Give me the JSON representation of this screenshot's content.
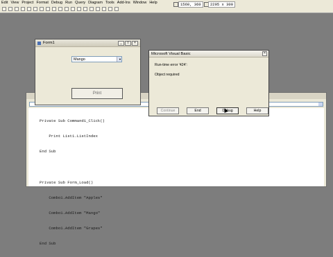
{
  "menu": [
    "Edit",
    "View",
    "Project",
    "Format",
    "Debug",
    "Run",
    "Query",
    "Diagram",
    "Tools",
    "Add-Ins",
    "Window",
    "Help"
  ],
  "toolbar": {
    "position": "1560, 360",
    "size": "2295 x 300"
  },
  "code": {
    "lines": [
      "Private Sub Command1_Click()",
      "    Print List1.ListIndex",
      "End Sub",
      "",
      "Private Sub Form_Load()",
      "    Combo1.AddItem \"Apples\"",
      "    Combo1.AddItem \"Mango\"",
      "    Combo1.AddItem \"Grapes\"",
      "End Sub"
    ]
  },
  "form1": {
    "title": "Form1",
    "combo_value": "Mango",
    "print_label": "Print"
  },
  "msgbox": {
    "title": "Microsoft Visual Basic",
    "line1": "Run-time error '424':",
    "line2": "Object required",
    "buttons": {
      "continue": "Continue",
      "end": "End",
      "debug": "Debug",
      "help": "Help"
    }
  }
}
